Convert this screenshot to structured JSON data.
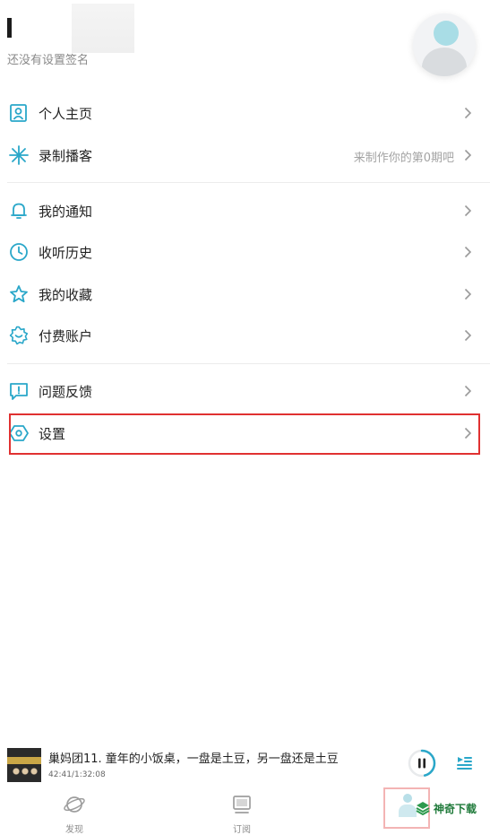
{
  "profile": {
    "signature": "还没有设置签名"
  },
  "menu": {
    "group1": [
      {
        "label": "个人主页",
        "hint": "",
        "icon": "user-card-icon"
      },
      {
        "label": "录制播客",
        "hint": "来制作你的第0期吧",
        "icon": "sparkle-icon"
      }
    ],
    "group2": [
      {
        "label": "我的通知",
        "hint": "",
        "icon": "bell-icon"
      },
      {
        "label": "收听历史",
        "hint": "",
        "icon": "clock-icon"
      },
      {
        "label": "我的收藏",
        "hint": "",
        "icon": "star-icon"
      },
      {
        "label": "付费账户",
        "hint": "",
        "icon": "badge-icon"
      }
    ],
    "group3": [
      {
        "label": "问题反馈",
        "hint": "",
        "icon": "feedback-icon"
      },
      {
        "label": "设置",
        "hint": "",
        "icon": "settings-icon"
      }
    ]
  },
  "player": {
    "title": "巢妈团11. 童年的小饭桌，一盘是土豆，另一盘还是土豆",
    "time": "42:41/1:32:08",
    "progress": 0.463
  },
  "tabs": [
    {
      "label": "发现",
      "icon": "planet-icon"
    },
    {
      "label": "订阅",
      "icon": "subscriptions-icon"
    }
  ],
  "watermark": {
    "text": "神奇下载"
  },
  "colors": {
    "accent": "#2aa7c9",
    "highlight_border": "#e03131"
  }
}
